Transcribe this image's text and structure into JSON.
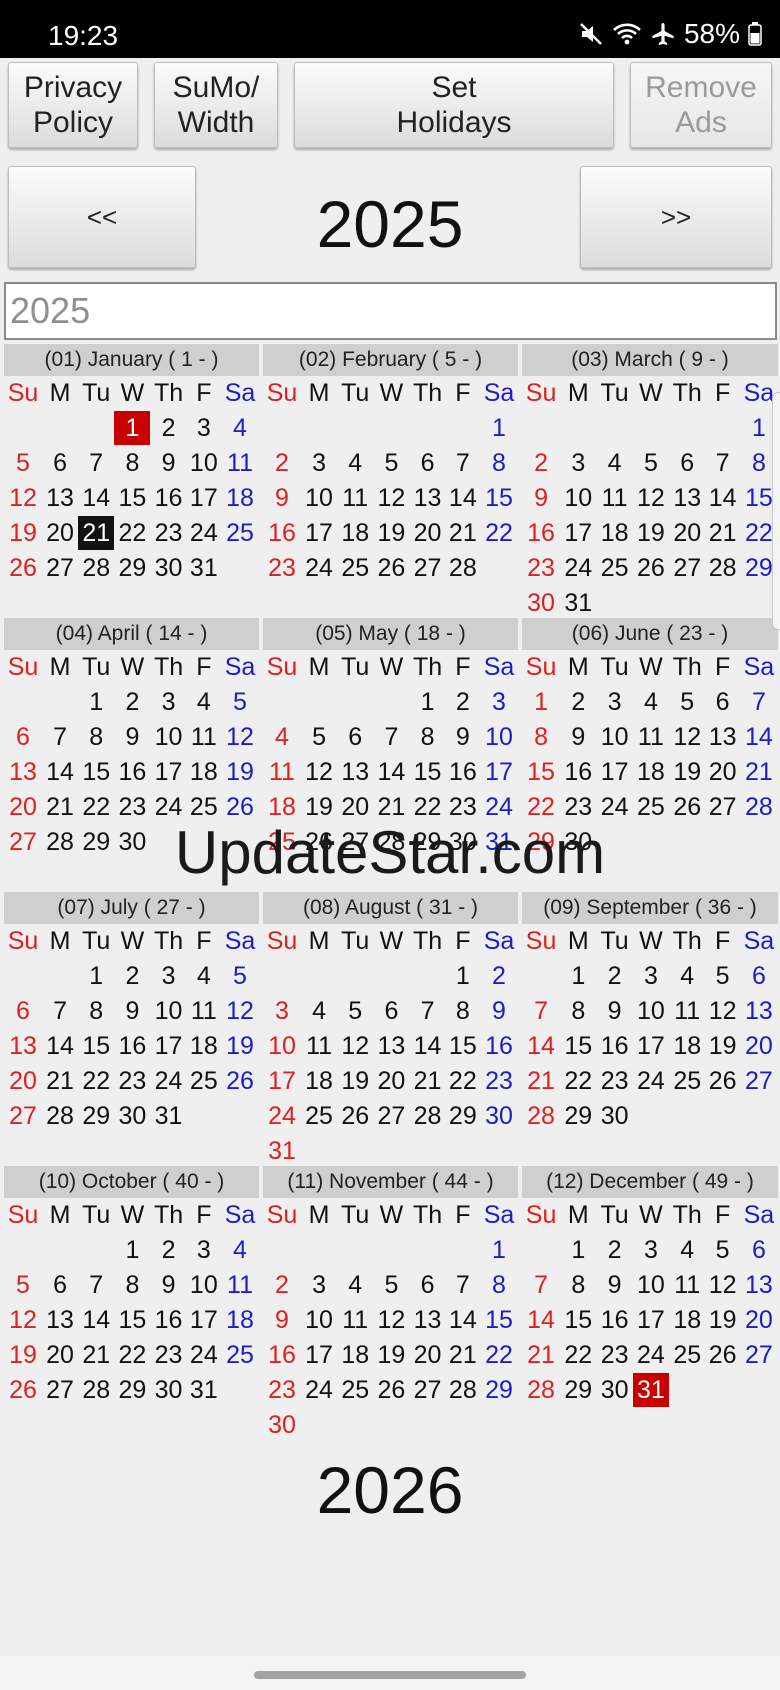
{
  "status": {
    "time": "19:23",
    "battery": "58%",
    "icons": [
      "mute-icon",
      "wifi-icon",
      "airplane-icon",
      "battery-icon"
    ]
  },
  "toolbar": {
    "privacy_label": "Privacy\nPolicy",
    "sumo_label": "SuMo/\nWidth",
    "holidays_label": "Set\nHolidays",
    "remove_ads_label": "Remove\nAds"
  },
  "nav": {
    "prev_label": "<<",
    "next_label": ">>",
    "year": "2025"
  },
  "year_input": {
    "value": "",
    "placeholder": "2025"
  },
  "weekday_labels": [
    "Su",
    "M",
    "Tu",
    "W",
    "Th",
    "F",
    "Sa"
  ],
  "months": [
    {
      "header": "(01) January ( 1 - )",
      "first_weekday": 3,
      "days": 31
    },
    {
      "header": "(02) February ( 5 - )",
      "first_weekday": 6,
      "days": 28
    },
    {
      "header": "(03) March ( 9 - )",
      "first_weekday": 6,
      "days": 31
    },
    {
      "header": "(04) April ( 14 - )",
      "first_weekday": 2,
      "days": 30
    },
    {
      "header": "(05) May ( 18 - )",
      "first_weekday": 4,
      "days": 31
    },
    {
      "header": "(06) June ( 23 - )",
      "first_weekday": 0,
      "days": 30
    },
    {
      "header": "(07) July ( 27 - )",
      "first_weekday": 2,
      "days": 31
    },
    {
      "header": "(08) August ( 31 - )",
      "first_weekday": 5,
      "days": 31
    },
    {
      "header": "(09) September ( 36 - )",
      "first_weekday": 1,
      "days": 30
    },
    {
      "header": "(10) October ( 40 - )",
      "first_weekday": 3,
      "days": 31
    },
    {
      "header": "(11) November ( 44 - )",
      "first_weekday": 6,
      "days": 30
    },
    {
      "header": "(12) December ( 49 - )",
      "first_weekday": 1,
      "days": 31
    }
  ],
  "highlights": [
    {
      "month": 1,
      "day": 1,
      "style": "holiday"
    },
    {
      "month": 1,
      "day": 21,
      "style": "today"
    },
    {
      "month": 12,
      "day": 31,
      "style": "holiday"
    }
  ],
  "colors": {
    "sunday": "#e02020",
    "saturday": "#1c1cc8",
    "holiday": "#c90000",
    "today": "#111111",
    "month_header_bg": "#cfcfcf"
  },
  "watermark": "UpdateStar.com",
  "next_year": "2026"
}
